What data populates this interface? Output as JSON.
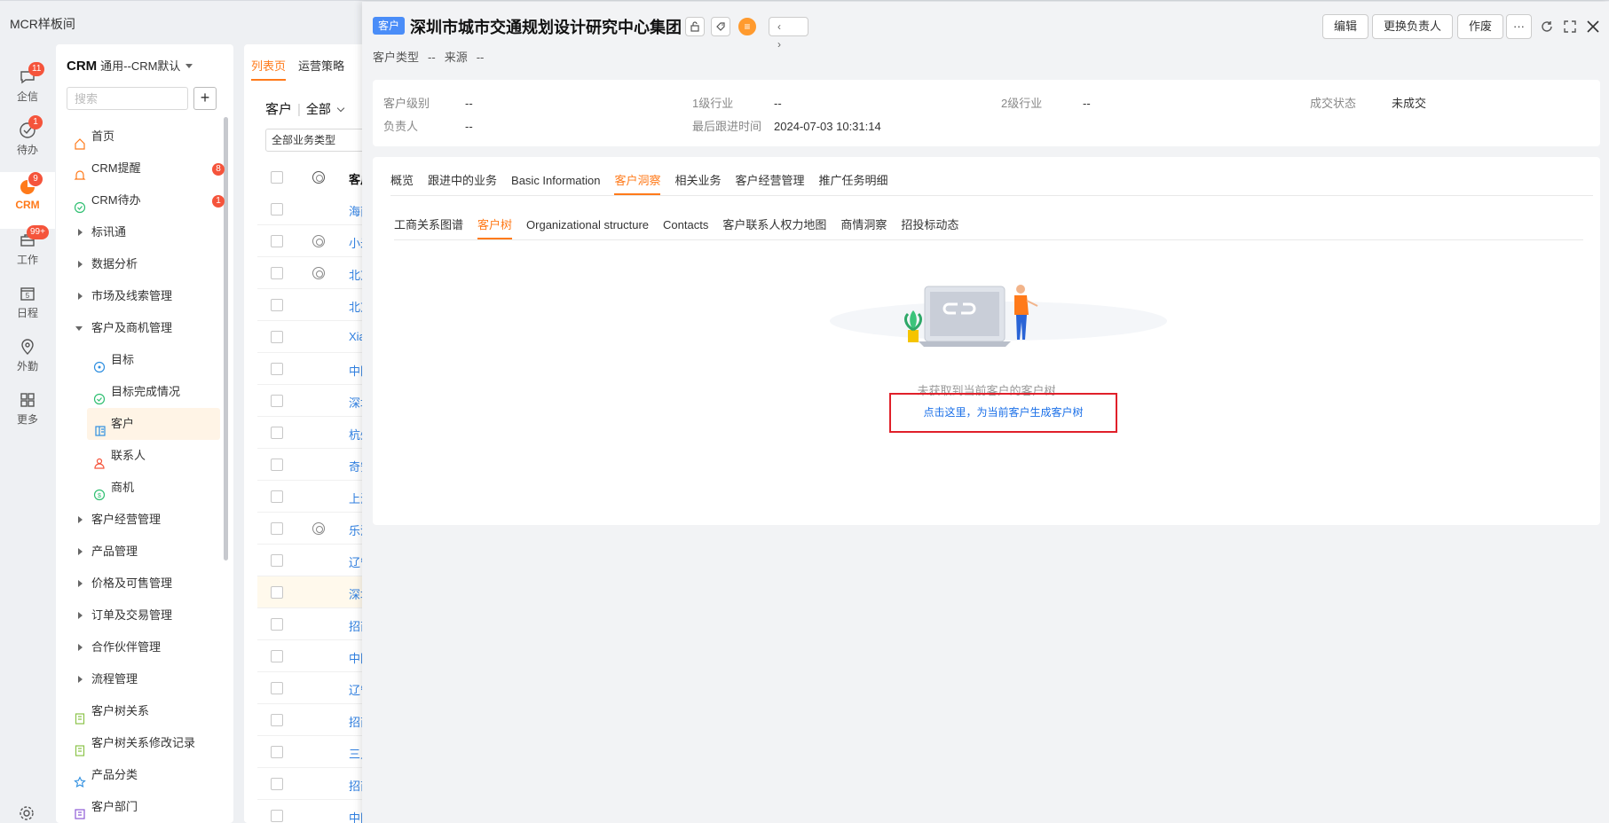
{
  "app": {
    "title": "MCR样板间"
  },
  "rail": [
    {
      "label": "企信",
      "badge": "11",
      "icon": "chat-icon"
    },
    {
      "label": "待办",
      "badge": "1",
      "icon": "check-circle-icon"
    },
    {
      "label": "CRM",
      "badge": "9",
      "icon": "crm-icon",
      "active": true
    },
    {
      "label": "工作",
      "badge": "99+",
      "icon": "briefcase-icon"
    },
    {
      "label": "日程",
      "badge": "",
      "icon": "calendar-icon",
      "calendar_day": "5"
    },
    {
      "label": "外勤",
      "badge": "",
      "icon": "location-pin-icon"
    },
    {
      "label": "更多",
      "badge": "",
      "icon": "grid-icon"
    }
  ],
  "sidebar": {
    "title": "CRM",
    "subtitle": "通用--CRM默认",
    "search_placeholder": "搜索",
    "add_label": "+",
    "items": [
      {
        "label": "首页",
        "type": "icon",
        "icon": "home-icon"
      },
      {
        "label": "CRM提醒",
        "type": "icon",
        "icon": "bell-icon",
        "badge": "8"
      },
      {
        "label": "CRM待办",
        "type": "icon",
        "icon": "check-circle-icon",
        "badge": "1"
      },
      {
        "label": "标讯通",
        "type": "group"
      },
      {
        "label": "数据分析",
        "type": "group"
      },
      {
        "label": "市场及线索管理",
        "type": "group"
      },
      {
        "label": "客户及商机管理",
        "type": "group-open"
      },
      {
        "label": "目标",
        "type": "sub",
        "icon": "target-icon"
      },
      {
        "label": "目标完成情况",
        "type": "sub",
        "icon": "check-circle-icon"
      },
      {
        "label": "客户",
        "type": "sub-selected",
        "icon": "customer-book-icon"
      },
      {
        "label": "联系人",
        "type": "sub",
        "icon": "contact-person-icon"
      },
      {
        "label": "商机",
        "type": "sub",
        "icon": "opportunity-icon"
      },
      {
        "label": "客户经营管理",
        "type": "group"
      },
      {
        "label": "产品管理",
        "type": "group"
      },
      {
        "label": "价格及可售管理",
        "type": "group"
      },
      {
        "label": "订单及交易管理",
        "type": "group"
      },
      {
        "label": "合作伙伴管理",
        "type": "group"
      },
      {
        "label": "流程管理",
        "type": "group"
      },
      {
        "label": "客户树关系",
        "type": "icon",
        "icon": "clipboard-icon"
      },
      {
        "label": "客户树关系修改记录",
        "type": "icon",
        "icon": "clipboard-icon"
      },
      {
        "label": "产品分类",
        "type": "icon",
        "icon": "star-icon"
      },
      {
        "label": "客户部门",
        "type": "icon",
        "icon": "department-icon"
      }
    ]
  },
  "listpanel": {
    "tabs": [
      "列表页",
      "运营策略"
    ],
    "title": "客户",
    "scope": "全部",
    "filter": "全部业务类型",
    "column_name": "客户",
    "rows": [
      {
        "name": "海南",
        "icon": false
      },
      {
        "name": "小米",
        "icon": true
      },
      {
        "name": "北京",
        "icon": true
      },
      {
        "name": "北京",
        "icon": false
      },
      {
        "name": "Xia",
        "icon": false
      },
      {
        "name": "中国",
        "icon": false
      },
      {
        "name": "深圳",
        "icon": false
      },
      {
        "name": "杭州",
        "icon": false
      },
      {
        "name": "奇安",
        "icon": false
      },
      {
        "name": "上海",
        "icon": false
      },
      {
        "name": "乐清",
        "icon": true
      },
      {
        "name": "辽宁",
        "icon": false
      },
      {
        "name": "深圳",
        "icon": false,
        "highlight": true
      },
      {
        "name": "招商",
        "icon": false
      },
      {
        "name": "中国",
        "icon": false
      },
      {
        "name": "辽宁",
        "icon": false
      },
      {
        "name": "招商",
        "icon": false
      },
      {
        "name": "三人",
        "icon": false
      },
      {
        "name": "招商",
        "icon": false
      },
      {
        "name": "中国",
        "icon": false
      }
    ]
  },
  "drawer": {
    "tag": "客户",
    "title": "深圳市城市交通规划设计研究中心集团",
    "meta_type_label": "客户类型",
    "meta_type_value": "--",
    "meta_source_label": "来源",
    "meta_source_value": "--",
    "buttons": {
      "edit": "编辑",
      "change_owner": "更换负责人",
      "void": "作废",
      "more": "···"
    },
    "nav": {
      "prev": "‹",
      "next": "›"
    },
    "info": [
      {
        "label": "客户级别",
        "value": "--"
      },
      {
        "label": "1级行业",
        "value": "--"
      },
      {
        "label": "2级行业",
        "value": "--"
      },
      {
        "label": "成交状态",
        "value": "未成交"
      },
      {
        "label": "负责人",
        "value": "--"
      },
      {
        "label": "最后跟进时间",
        "value": "2024-07-03 10:31:14"
      }
    ],
    "tabs": [
      "概览",
      "跟进中的业务",
      "Basic Information",
      "客户洞察",
      "相关业务",
      "客户经营管理",
      "推广任务明细"
    ],
    "active_tab": 3,
    "subtabs": [
      "工商关系图谱",
      "客户树",
      "Organizational structure",
      "Contacts",
      "客户联系人权力地图",
      "商情洞察",
      "招投标动态"
    ],
    "active_subtab": 1,
    "empty_text": "未获取到当前客户的客户树",
    "generate_link": "点击这里，为当前客户生成客户树"
  },
  "colors": {
    "accent": "#ff7a1a",
    "link": "#1a6fe8",
    "badge": "#f5543b",
    "highlight_box": "#e0202a",
    "tag": "#4a8df8"
  }
}
